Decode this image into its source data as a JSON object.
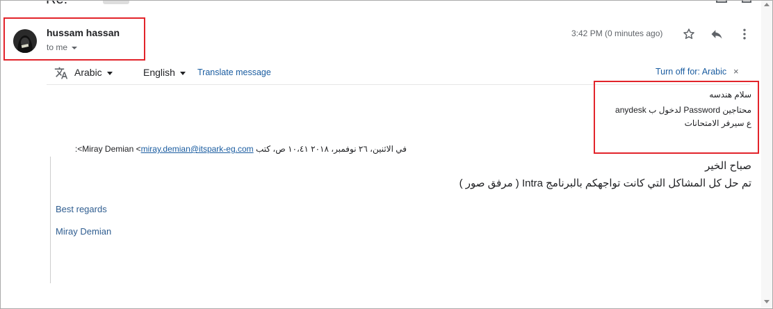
{
  "subject": {
    "text": "Re:"
  },
  "sender": {
    "name": "hussam hassan",
    "to_label": "to me"
  },
  "header": {
    "timestamp": "3:42 PM (0 minutes ago)"
  },
  "translate_bar": {
    "source_language": "Arabic",
    "target_language": "English",
    "translate_link": "Translate message",
    "turn_off_link": "Turn off for: Arabic",
    "close_symbol": "×"
  },
  "message": {
    "lines": [
      "سلام هندسه",
      "محتاجين Password لدخول ب anydesk",
      "ع سيرفر الامتحانات"
    ]
  },
  "quote": {
    "attribution_prefix": "في الاثنين، ٢٦ نوفمبر، ٢٠١٨ ١٠،٤١ ص، كتب Miray Demian <",
    "attribution_email": "miray.demian@itspark-eg.com",
    "attribution_suffix": ">:",
    "greeting": "صباح الخير",
    "body": "تم حل كل المشاكل التي كانت تواجهكم بالبرنامج Intra ( مرفق صور )",
    "signature_1": "Best regards",
    "signature_2": "Miray Demian"
  },
  "colors": {
    "highlight": "#e2232a",
    "link": "#1a5ca0",
    "signature": "#2f5d90",
    "muted_text": "#5f6368"
  },
  "icons": {
    "star": "star-icon",
    "reply": "reply-icon",
    "more": "more-vert-icon",
    "translate": "translate-icon",
    "print": "print-icon",
    "new_window": "open-in-new-icon"
  }
}
